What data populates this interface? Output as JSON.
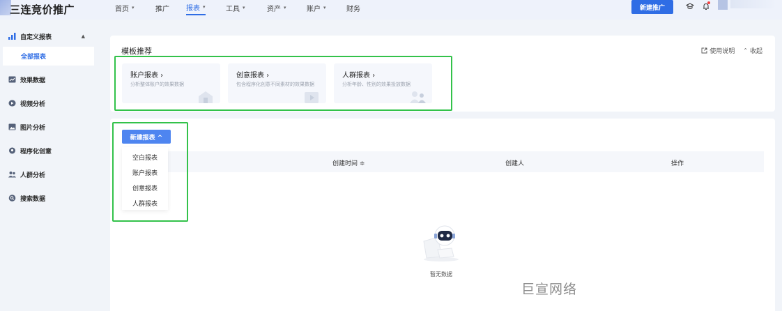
{
  "app": {
    "title": "三连竞价推广"
  },
  "nav": {
    "items": [
      {
        "label": "首页",
        "caret": "▾"
      },
      {
        "label": "推广",
        "caret": ""
      },
      {
        "label": "报表",
        "caret": "▾"
      },
      {
        "label": "工具",
        "caret": "▾"
      },
      {
        "label": "资产",
        "caret": "▾"
      },
      {
        "label": "账户",
        "caret": "▾"
      },
      {
        "label": "财务",
        "caret": ""
      }
    ],
    "active_label": "报表",
    "new_promo_label": "新建推广"
  },
  "sidebar": {
    "group_label": "自定义报表",
    "group_arrow": "▲",
    "sub_label": "全部报表",
    "items": [
      {
        "label": "效果数据"
      },
      {
        "label": "视频分析"
      },
      {
        "label": "图片分析"
      },
      {
        "label": "程序化创意"
      },
      {
        "label": "人群分析"
      },
      {
        "label": "搜索数据"
      }
    ]
  },
  "templates": {
    "title": "模板推荐",
    "help_label": "使用说明",
    "collapse_label": "收起",
    "cards": [
      {
        "title": "账户报表 ›",
        "desc": "分析整体账户的效果数据"
      },
      {
        "title": "创意报表 ›",
        "desc": "包含程序化创意不同素材的效果数据"
      },
      {
        "title": "人群报表 ›",
        "desc": "分析年龄、性别的效果投放数据"
      }
    ]
  },
  "report": {
    "new_report_label": "新建报表 ^",
    "dropdown": [
      "空白报表",
      "账户报表",
      "创意报表",
      "人群报表"
    ],
    "columns": {
      "created_time": "创建时间 ≑",
      "creator": "创建人",
      "action": "操作"
    },
    "empty_text": "暂无数据"
  },
  "watermark": "巨宣网络",
  "colors": {
    "primary": "#2f6de5",
    "highlight_box": "#33c24a"
  }
}
